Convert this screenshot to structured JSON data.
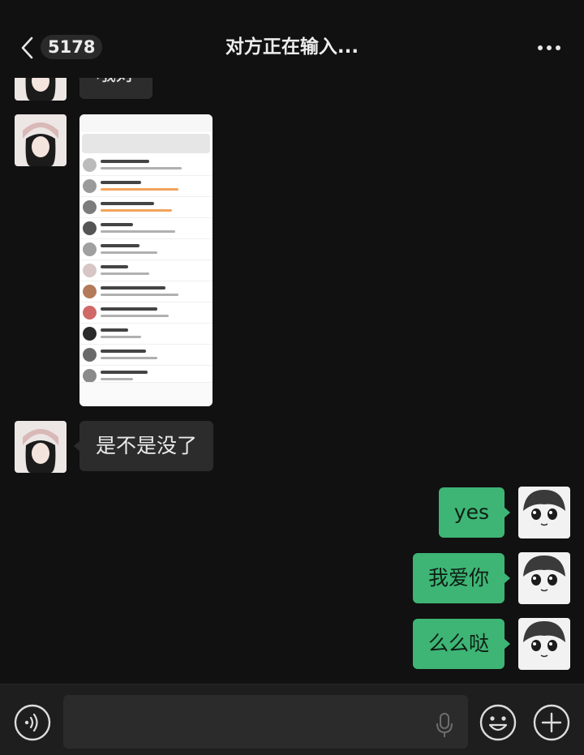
{
  "header": {
    "unread_count": "5178",
    "title": "对方正在输入..."
  },
  "messages": [
    {
      "from": "contact",
      "type": "text",
      "text": "哦好"
    },
    {
      "from": "contact",
      "type": "image"
    },
    {
      "from": "contact",
      "type": "text",
      "text": "是不是没了"
    },
    {
      "from": "me",
      "type": "text",
      "text": "yes"
    },
    {
      "from": "me",
      "type": "text",
      "text": "我爱你"
    },
    {
      "from": "me",
      "type": "text",
      "text": "么么哒"
    }
  ],
  "input": {
    "value": ""
  },
  "colors": {
    "background": "#111111",
    "incoming_bubble": "#2c2c2c",
    "outgoing_bubble": "#3eb575",
    "input_bar": "#1e1e1e"
  },
  "icons": [
    "back-chevron-icon",
    "more-icon",
    "voice-icon",
    "microphone-icon",
    "emoji-icon",
    "plus-icon"
  ]
}
